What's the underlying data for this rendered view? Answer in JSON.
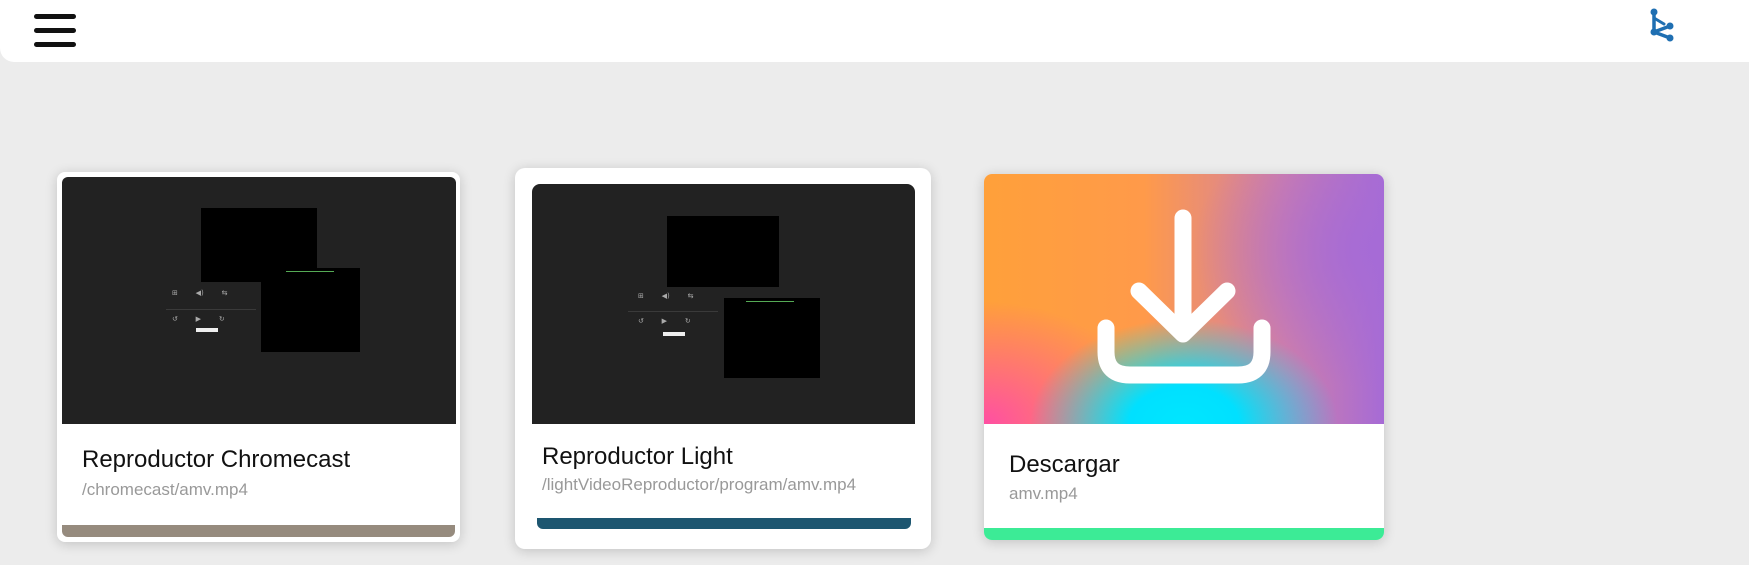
{
  "cards": [
    {
      "title": "Reproductor Chromecast",
      "subtitle": "/chromecast/amv.mp4",
      "bar_color": "#968b7e"
    },
    {
      "title": "Reproductor Light",
      "subtitle": "/lightVideoReproductor/program/amv.mp4",
      "bar_color": "#1d5670"
    },
    {
      "title": "Descargar",
      "subtitle": "amv.mp4",
      "bar_color": "#3ceb96"
    }
  ],
  "icons": {
    "menu": "hamburger-menu-icon",
    "share": "share-icon",
    "download": "download-icon"
  },
  "colors": {
    "background": "#ececec",
    "thumb_dark": "#222222",
    "share_icon": "#1f6fb2"
  }
}
